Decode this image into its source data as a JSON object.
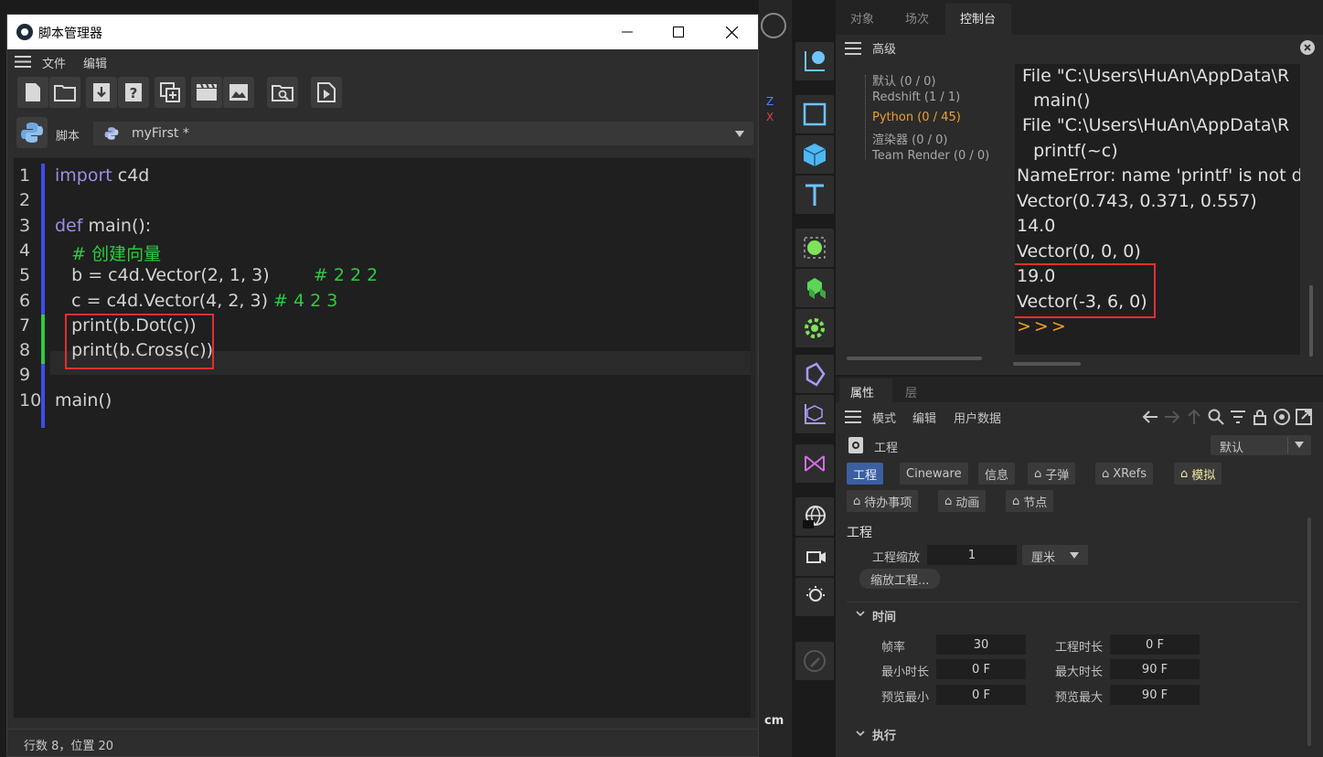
{
  "script_manager": {
    "title": "脚本管理器",
    "menu": [
      "文件",
      "编辑"
    ],
    "script_label": "脚本",
    "script_name": "myFirst *",
    "code_lines": [
      {
        "num": "1",
        "parts": [
          {
            "t": "import",
            "c": "kw"
          },
          {
            "t": " c4d",
            "c": ""
          }
        ]
      },
      {
        "num": "2",
        "parts": []
      },
      {
        "num": "3",
        "parts": [
          {
            "t": "def",
            "c": "kw"
          },
          {
            "t": " main():",
            "c": ""
          }
        ]
      },
      {
        "num": "4",
        "parts": [
          {
            "t": "   # 创建向量",
            "c": "cm"
          }
        ]
      },
      {
        "num": "5",
        "parts": [
          {
            "t": "   b = c4d.Vector(2, 1, 3)        ",
            "c": ""
          },
          {
            "t": "# 2 2 2",
            "c": "cm"
          }
        ]
      },
      {
        "num": "6",
        "parts": [
          {
            "t": "   c = c4d.Vector(4, 2, 3) ",
            "c": ""
          },
          {
            "t": "# 4 2 3",
            "c": "cm"
          }
        ]
      },
      {
        "num": "7",
        "parts": [
          {
            "t": "   print(b.Dot(c))",
            "c": ""
          }
        ]
      },
      {
        "num": "8",
        "parts": [
          {
            "t": "   print(b.Cross(c))",
            "c": ""
          }
        ]
      },
      {
        "num": "9",
        "parts": []
      },
      {
        "num": "10",
        "parts": [
          {
            "t": "main()",
            "c": ""
          }
        ]
      }
    ],
    "status": "行数 8，位置 20"
  },
  "console": {
    "tabs": [
      "对象",
      "场次",
      "控制台"
    ],
    "active_tab": "控制台",
    "header": "高级",
    "tree": [
      "默认 (0 / 0)",
      "Redshift (1 / 1)",
      "Python (0 / 45)",
      "渲染器 (0 / 0)",
      "Team Render  (0 / 0)"
    ],
    "output": [
      " File \"C:\\Users\\HuAn\\AppData\\R",
      "   main()",
      " File \"C:\\Users\\HuAn\\AppData\\R",
      "   printf(~c)",
      "NameError: name 'printf' is not d",
      "Vector(0.743, 0.371, 0.557)",
      "14.0",
      "Vector(0, 0, 0)",
      "19.0",
      "Vector(-3, 6, 0)",
      ">>>"
    ]
  },
  "attributes": {
    "tabs": [
      "属性",
      "层"
    ],
    "menu": [
      "模式",
      "编辑",
      "用户数据"
    ],
    "object": "工程",
    "preset": "默认",
    "chips_row1": [
      "工程",
      "Cineware",
      "信息",
      "子弹",
      "XRefs",
      "模拟"
    ],
    "chips_row2": [
      "待办事项",
      "动画",
      "节点"
    ],
    "section_project": "工程",
    "scale_label": "工程缩放",
    "scale_value": "1",
    "scale_unit": "厘米",
    "scale_button": "缩放工程...",
    "section_time": "时间",
    "fps_label": "帧率",
    "fps_value": "30",
    "duration_label": "工程时长",
    "duration_value": "0 F",
    "min_label": "最小时长",
    "min_value": "0 F",
    "max_label": "最大时长",
    "max_value": "90 F",
    "pmin_label": "预览最小",
    "pmin_value": "0 F",
    "pmax_label": "预览最大",
    "pmax_value": "90 F",
    "section_exec": "执行"
  },
  "viewport": {
    "unit": "cm",
    "axis_z": "Z",
    "axis_x": "X"
  }
}
